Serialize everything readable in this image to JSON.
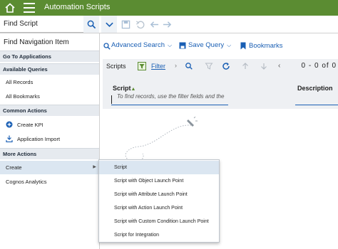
{
  "app": {
    "title": "Automation Scripts",
    "brand_color": "#5b8c32"
  },
  "findbar": {
    "find_value": "Find Script"
  },
  "nav": {
    "title": "Find Navigation Item",
    "sections": [
      {
        "header": "Go To Applications",
        "items": []
      },
      {
        "header": "Available Queries",
        "items": [
          "All Records",
          "All Bookmarks"
        ]
      },
      {
        "header": "Common Actions",
        "items": [
          "Create KPI",
          "Application Import"
        ]
      },
      {
        "header": "More Actions",
        "items": [
          "Create",
          "Cognos Analytics"
        ]
      }
    ]
  },
  "toolbar": {
    "advanced_search": "Advanced Search",
    "save_query": "Save Query",
    "bookmarks": "Bookmarks"
  },
  "table": {
    "title": "Scripts",
    "filter_label": "Filter",
    "pager": "0 - 0 of 0",
    "columns": [
      "Script",
      "Description"
    ],
    "empty_hint": "To find records, use the filter fields and the"
  },
  "create_menu": {
    "items": [
      "Script",
      "Script with Object Launch Point",
      "Script with Attribute Launch Point",
      "Script with Action Launch Point",
      "Script with Custom Condition Launch Point",
      "Script for Integration"
    ],
    "highlighted_index": 0
  },
  "icons": {
    "home": "home-icon",
    "menu": "hamburger-menu-icon",
    "search": "search-icon",
    "dropdown": "chevron-down-icon",
    "save": "save-icon",
    "undo": "undo-icon",
    "back": "arrow-left-icon",
    "forward": "arrow-right-icon",
    "bookmark": "bookmark-icon",
    "refresh": "refresh-icon"
  }
}
